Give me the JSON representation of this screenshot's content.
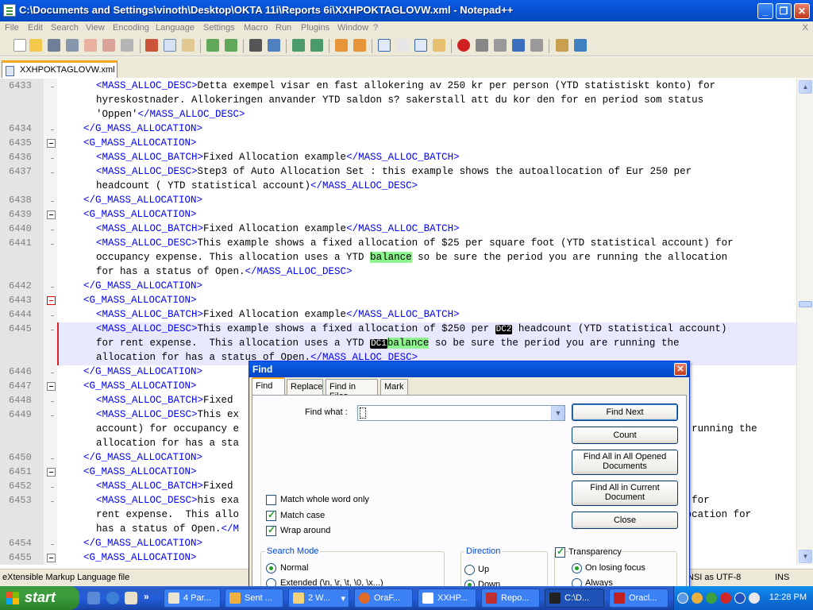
{
  "window": {
    "title": "C:\\Documents and Settings\\vinoth\\Desktop\\OKTA 11i\\Reports 6i\\XXHPOKTAGLOVW.xml - Notepad++",
    "minimize": "_",
    "maximize": "❐",
    "close": "✕"
  },
  "menu": {
    "items": [
      "File",
      "Edit",
      "Search",
      "View",
      "Encoding",
      "Language",
      "Settings",
      "Macro",
      "Run",
      "Plugins",
      "Window",
      "?"
    ],
    "close": "X"
  },
  "tab": {
    "label": "XXHPOKTAGLOVW.xml"
  },
  "editor": {
    "lines": [
      {
        "num": "6433",
        "parts": [
          [
            "tag",
            "<MASS_ALLOC_DESC>"
          ],
          [
            "txt",
            "Detta exempel visar en fast allokering av 250 kr per person (YTD statistiskt konto) for"
          ]
        ]
      },
      {
        "num": "",
        "parts": [
          [
            "txt",
            "hyreskostnader. Allokeringen anvander YTD saldon s? sakerstall att du kor den for en period som status"
          ]
        ]
      },
      {
        "num": "",
        "parts": [
          [
            "txt",
            "'Oppen'"
          ],
          [
            "tag",
            "</MASS_ALLOC_DESC>"
          ]
        ]
      },
      {
        "num": "6434",
        "parts": [
          [
            "tag",
            "</G_MASS_ALLOCATION>"
          ]
        ]
      },
      {
        "num": "6435",
        "parts": [
          [
            "tag",
            "<G_MASS_ALLOCATION>"
          ]
        ]
      },
      {
        "num": "6436",
        "parts": [
          [
            "tag",
            "<MASS_ALLOC_BATCH>"
          ],
          [
            "txt",
            "Fixed Allocation example"
          ],
          [
            "tag",
            "</MASS_ALLOC_BATCH>"
          ]
        ]
      },
      {
        "num": "6437",
        "parts": [
          [
            "tag",
            "<MASS_ALLOC_DESC>"
          ],
          [
            "txt",
            "Step3 of Auto Allocation Set : this example shows the autoallocation of Eur 250 per"
          ]
        ]
      },
      {
        "num": "",
        "parts": [
          [
            "txt",
            "headcount ( YTD statistical account)"
          ],
          [
            "tag",
            "</MASS_ALLOC_DESC>"
          ]
        ]
      },
      {
        "num": "6438",
        "parts": [
          [
            "tag",
            "</G_MASS_ALLOCATION>"
          ]
        ]
      },
      {
        "num": "6439",
        "parts": [
          [
            "tag",
            "<G_MASS_ALLOCATION>"
          ]
        ]
      },
      {
        "num": "6440",
        "parts": [
          [
            "tag",
            "<MASS_ALLOC_BATCH>"
          ],
          [
            "txt",
            "Fixed Allocation example"
          ],
          [
            "tag",
            "</MASS_ALLOC_BATCH>"
          ]
        ]
      },
      {
        "num": "6441",
        "parts": [
          [
            "tag",
            "<MASS_ALLOC_DESC>"
          ],
          [
            "txt",
            "This example shows a fixed allocation of $25 per square foot (YTD statistical account) for"
          ]
        ]
      },
      {
        "num": "",
        "parts": [
          [
            "txt",
            "occupancy expense. This allocation uses a YTD "
          ],
          [
            "hl",
            "balance"
          ],
          [
            "txt",
            " so be sure the period you are running the allocation"
          ]
        ]
      },
      {
        "num": "",
        "parts": [
          [
            "txt",
            "for has a status of Open."
          ],
          [
            "tag",
            "</MASS_ALLOC_DESC>"
          ]
        ]
      },
      {
        "num": "6442",
        "parts": [
          [
            "tag",
            "</G_MASS_ALLOCATION>"
          ]
        ]
      },
      {
        "num": "6443",
        "parts": [
          [
            "tag",
            "<G_MASS_ALLOCATION>"
          ]
        ]
      },
      {
        "num": "6444",
        "parts": [
          [
            "tag",
            "<MASS_ALLOC_BATCH>"
          ],
          [
            "txt",
            "Fixed Allocation example"
          ],
          [
            "tag",
            "</MASS_ALLOC_BATCH>"
          ]
        ]
      },
      {
        "num": "6445",
        "parts": [
          [
            "tag",
            "<MASS_ALLOC_DESC>"
          ],
          [
            "txt",
            "This example shows a fixed allocation of $250 per "
          ],
          [
            "mk",
            "DC2"
          ],
          [
            "txt",
            " headcount (YTD statistical account)"
          ]
        ]
      },
      {
        "num": "",
        "parts": [
          [
            "txt",
            "for rent expense.  This allocation uses a YTD "
          ],
          [
            "mk",
            "DC1"
          ],
          [
            "hl",
            "balance"
          ],
          [
            "txt",
            " so be sure the period you are running the"
          ]
        ]
      },
      {
        "num": "",
        "parts": [
          [
            "txt",
            "allocation for has a status of Open."
          ],
          [
            "tag",
            "</MASS_ALLOC_DESC>"
          ]
        ]
      },
      {
        "num": "6446",
        "parts": [
          [
            "tag",
            "</G_MASS_ALLOCATION>"
          ]
        ]
      },
      {
        "num": "6447",
        "parts": [
          [
            "tag",
            "<G_MASS_ALLOCATION>"
          ]
        ]
      },
      {
        "num": "6448",
        "parts": [
          [
            "tag",
            "<MASS_ALLOC_BATCH>"
          ],
          [
            "txt",
            "Fixed"
          ]
        ]
      },
      {
        "num": "6449",
        "parts": [
          [
            "tag",
            "<MASS_ALLOC_DESC>"
          ],
          [
            "txt",
            "This ex"
          ],
          [
            "txt",
            "                                                                  "
          ],
          [
            "txt",
            "istical"
          ]
        ]
      },
      {
        "num": "",
        "parts": [
          [
            "txt",
            "account) for occupancy e"
          ],
          [
            "txt",
            "                                                                        "
          ],
          [
            "txt",
            "are running the"
          ]
        ]
      },
      {
        "num": "",
        "parts": [
          [
            "txt",
            "allocation for has a sta"
          ]
        ]
      },
      {
        "num": "6450",
        "parts": [
          [
            "tag",
            "</G_MASS_ALLOCATION>"
          ]
        ]
      },
      {
        "num": "6451",
        "parts": [
          [
            "tag",
            "<G_MASS_ALLOCATION>"
          ]
        ]
      },
      {
        "num": "6452",
        "parts": [
          [
            "tag",
            "<MASS_ALLOC_BATCH>"
          ],
          [
            "txt",
            "Fixed"
          ]
        ]
      },
      {
        "num": "6453",
        "parts": [
          [
            "tag",
            "<MASS_ALLOC_DESC>"
          ],
          [
            "txt",
            "his exa"
          ],
          [
            "txt",
            "                                                                   "
          ],
          [
            "txt",
            "account) for"
          ]
        ]
      },
      {
        "num": "",
        "parts": [
          [
            "txt",
            "rent expense.  This allo"
          ],
          [
            "txt",
            "                                                                         "
          ],
          [
            "txt",
            "llocation for"
          ]
        ]
      },
      {
        "num": "",
        "parts": [
          [
            "txt",
            "has a status of Open."
          ],
          [
            "tag",
            "</M"
          ]
        ]
      },
      {
        "num": "6454",
        "parts": [
          [
            "tag",
            "</G_MASS_ALLOCATION>"
          ]
        ]
      },
      {
        "num": "6455",
        "parts": [
          [
            "tag",
            "<G_MASS_ALLOCATION>"
          ]
        ]
      }
    ]
  },
  "status": {
    "type": "eXtensible Markup Language file",
    "encoding": "NSI as UTF-8",
    "mode": "INS"
  },
  "find": {
    "title": "Find",
    "tabs": [
      "Find",
      "Replace",
      "Find in Files",
      "Mark"
    ],
    "find_what_label": "Find what :",
    "find_what_value": "",
    "dropdown_arrow": "▼",
    "buttons": {
      "find_next": "Find Next",
      "count": "Count",
      "find_all_opened_1": "Find All in All Opened",
      "find_all_opened_2": "Documents",
      "find_all_current_1": "Find All in Current",
      "find_all_current_2": "Document",
      "close": "Close"
    },
    "options": {
      "whole_word": "Match whole word only",
      "match_case": "Match case",
      "wrap": "Wrap around"
    },
    "search_mode": {
      "label": "Search Mode",
      "normal": "Normal",
      "extended": "Extended (\\n, \\r, \\t, \\0, \\x...)"
    },
    "direction": {
      "label": "Direction",
      "up": "Up",
      "down": "Down"
    },
    "transparency": {
      "label": "Transparency",
      "on_losing_focus": "On losing focus",
      "always": "Always"
    }
  },
  "taskbar": {
    "start": "start",
    "tasks": [
      "4 Par...",
      "Sent ...",
      "2 W...",
      "OraF...",
      "XXHP...",
      "Repo...",
      "C:\\D...",
      "Oracl..."
    ],
    "time": "12:28 PM",
    "overflow": "»",
    "task_arrow": "▾"
  }
}
